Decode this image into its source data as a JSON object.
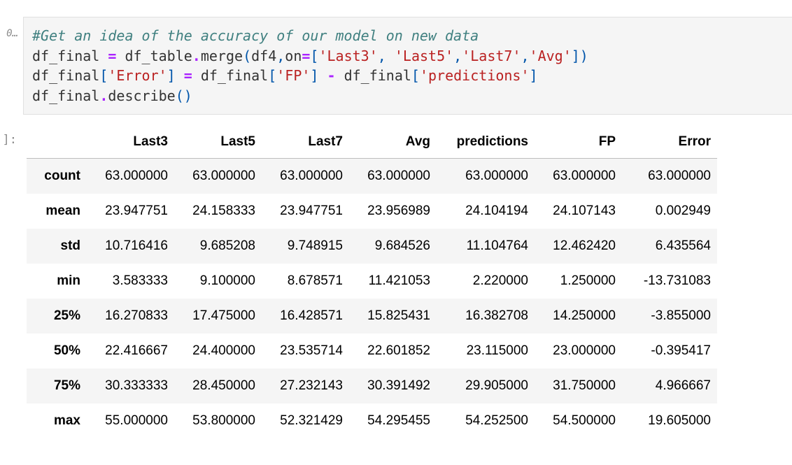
{
  "cell": {
    "in_prompt": "0…",
    "out_prompt": "]:",
    "code_lines": [
      [
        {
          "t": "#Get an idea of the accuracy of our model on new data",
          "c": "cm"
        }
      ],
      [
        {
          "t": "df_final ",
          "c": ""
        },
        {
          "t": "=",
          "c": "op"
        },
        {
          "t": " df_table",
          "c": ""
        },
        {
          "t": ".",
          "c": "op"
        },
        {
          "t": "merge",
          "c": ""
        },
        {
          "t": "(",
          "c": "pt"
        },
        {
          "t": "df4",
          "c": ""
        },
        {
          "t": ",",
          "c": "pt"
        },
        {
          "t": "on",
          "c": ""
        },
        {
          "t": "=",
          "c": "op"
        },
        {
          "t": "[",
          "c": "pt"
        },
        {
          "t": "'Last3'",
          "c": "st"
        },
        {
          "t": ", ",
          "c": "pt"
        },
        {
          "t": "'Last5'",
          "c": "st"
        },
        {
          "t": ",",
          "c": "pt"
        },
        {
          "t": "'Last7'",
          "c": "st"
        },
        {
          "t": ",",
          "c": "pt"
        },
        {
          "t": "'Avg'",
          "c": "st"
        },
        {
          "t": "])",
          "c": "pt"
        }
      ],
      [
        {
          "t": "df_final",
          "c": ""
        },
        {
          "t": "[",
          "c": "pt"
        },
        {
          "t": "'Error'",
          "c": "st"
        },
        {
          "t": "]",
          "c": "pt"
        },
        {
          "t": " ",
          "c": ""
        },
        {
          "t": "=",
          "c": "op"
        },
        {
          "t": " df_final",
          "c": ""
        },
        {
          "t": "[",
          "c": "pt"
        },
        {
          "t": "'FP'",
          "c": "st"
        },
        {
          "t": "]",
          "c": "pt"
        },
        {
          "t": " ",
          "c": ""
        },
        {
          "t": "-",
          "c": "op"
        },
        {
          "t": " df_final",
          "c": ""
        },
        {
          "t": "[",
          "c": "pt"
        },
        {
          "t": "'predictions'",
          "c": "st"
        },
        {
          "t": "]",
          "c": "pt"
        }
      ],
      [
        {
          "t": "df_final",
          "c": ""
        },
        {
          "t": ".",
          "c": "op"
        },
        {
          "t": "describe",
          "c": ""
        },
        {
          "t": "()",
          "c": "pt"
        }
      ]
    ]
  },
  "table": {
    "columns": [
      "",
      "Last3",
      "Last5",
      "Last7",
      "Avg",
      "predictions",
      "FP",
      "Error"
    ],
    "rows": [
      {
        "label": "count",
        "values": [
          "63.000000",
          "63.000000",
          "63.000000",
          "63.000000",
          "63.000000",
          "63.000000",
          "63.000000"
        ]
      },
      {
        "label": "mean",
        "values": [
          "23.947751",
          "24.158333",
          "23.947751",
          "23.956989",
          "24.104194",
          "24.107143",
          "0.002949"
        ]
      },
      {
        "label": "std",
        "values": [
          "10.716416",
          "9.685208",
          "9.748915",
          "9.684526",
          "11.104764",
          "12.462420",
          "6.435564"
        ]
      },
      {
        "label": "min",
        "values": [
          "3.583333",
          "9.100000",
          "8.678571",
          "11.421053",
          "2.220000",
          "1.250000",
          "-13.731083"
        ]
      },
      {
        "label": "25%",
        "values": [
          "16.270833",
          "17.475000",
          "16.428571",
          "15.825431",
          "16.382708",
          "14.250000",
          "-3.855000"
        ]
      },
      {
        "label": "50%",
        "values": [
          "22.416667",
          "24.400000",
          "23.535714",
          "22.601852",
          "23.115000",
          "23.000000",
          "-0.395417"
        ]
      },
      {
        "label": "75%",
        "values": [
          "30.333333",
          "28.450000",
          "27.232143",
          "30.391492",
          "29.905000",
          "31.750000",
          "4.966667"
        ]
      },
      {
        "label": "max",
        "values": [
          "55.000000",
          "53.800000",
          "52.321429",
          "54.295455",
          "54.252500",
          "54.500000",
          "19.605000"
        ]
      }
    ]
  }
}
